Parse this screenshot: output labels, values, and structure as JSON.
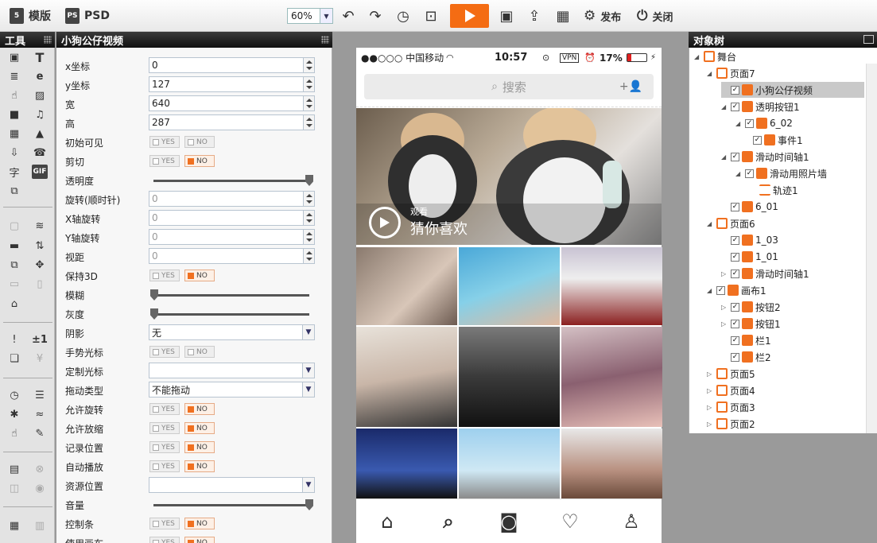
{
  "toolbar": {
    "template_label": "模版",
    "psd_label": "PSD",
    "zoom_value": "60%",
    "publish_label": "发布",
    "close_label": "关闭"
  },
  "tools_panel": {
    "title": "工具"
  },
  "props_panel": {
    "title": "小狗公仔视频",
    "rows": [
      {
        "label": "x坐标",
        "value": "0"
      },
      {
        "label": "y坐标",
        "value": "127"
      },
      {
        "label": "宽",
        "value": "640"
      },
      {
        "label": "高",
        "value": "287"
      },
      {
        "label": "初始可见"
      },
      {
        "label": "剪切"
      },
      {
        "label": "透明度"
      },
      {
        "label": "旋转(顺时针)",
        "value": "0"
      },
      {
        "label": "X轴旋转",
        "value": "0"
      },
      {
        "label": "Y轴旋转",
        "value": "0"
      },
      {
        "label": "视距",
        "value": "0"
      },
      {
        "label": "保持3D"
      },
      {
        "label": "模糊"
      },
      {
        "label": "灰度"
      },
      {
        "label": "阴影",
        "value": "无"
      },
      {
        "label": "手势光标"
      },
      {
        "label": "定制光标",
        "value": ""
      },
      {
        "label": "拖动类型",
        "value": "不能拖动"
      },
      {
        "label": "允许旋转"
      },
      {
        "label": "允许放缩"
      },
      {
        "label": "记录位置"
      },
      {
        "label": "自动播放"
      },
      {
        "label": "资源位置",
        "value": ""
      },
      {
        "label": "音量"
      },
      {
        "label": "控制条"
      },
      {
        "label": "使用画布"
      }
    ],
    "yes_label": "YES",
    "no_label": "NO"
  },
  "phone": {
    "carrier": "●●○○○ 中国移动",
    "time": "10:57",
    "vpn": "VPN",
    "battery": "17%",
    "search_placeholder": "搜索",
    "hero_small": "观看",
    "hero_text": "猜你喜欢"
  },
  "tree": {
    "title": "对象树",
    "nodes": [
      {
        "label": "舞台"
      },
      {
        "label": "页面7"
      },
      {
        "label": "小狗公仔视频"
      },
      {
        "label": "透明按钮1"
      },
      {
        "label": "6_02"
      },
      {
        "label": "事件1"
      },
      {
        "label": "滑动时间轴1"
      },
      {
        "label": "滑动用照片墙"
      },
      {
        "label": "轨迹1"
      },
      {
        "label": "6_01"
      },
      {
        "label": "页面6"
      },
      {
        "label": "1_03"
      },
      {
        "label": "1_01"
      },
      {
        "label": "滑动时间轴1"
      },
      {
        "label": "画布1"
      },
      {
        "label": "按钮2"
      },
      {
        "label": "按钮1"
      },
      {
        "label": "栏1"
      },
      {
        "label": "栏2"
      },
      {
        "label": "页面5"
      },
      {
        "label": "页面4"
      },
      {
        "label": "页面3"
      },
      {
        "label": "页面2"
      }
    ]
  },
  "colors": {
    "accent": "#f46c13",
    "panel_header": "#1a1a1a",
    "selected_row": "#c9c9c9"
  }
}
